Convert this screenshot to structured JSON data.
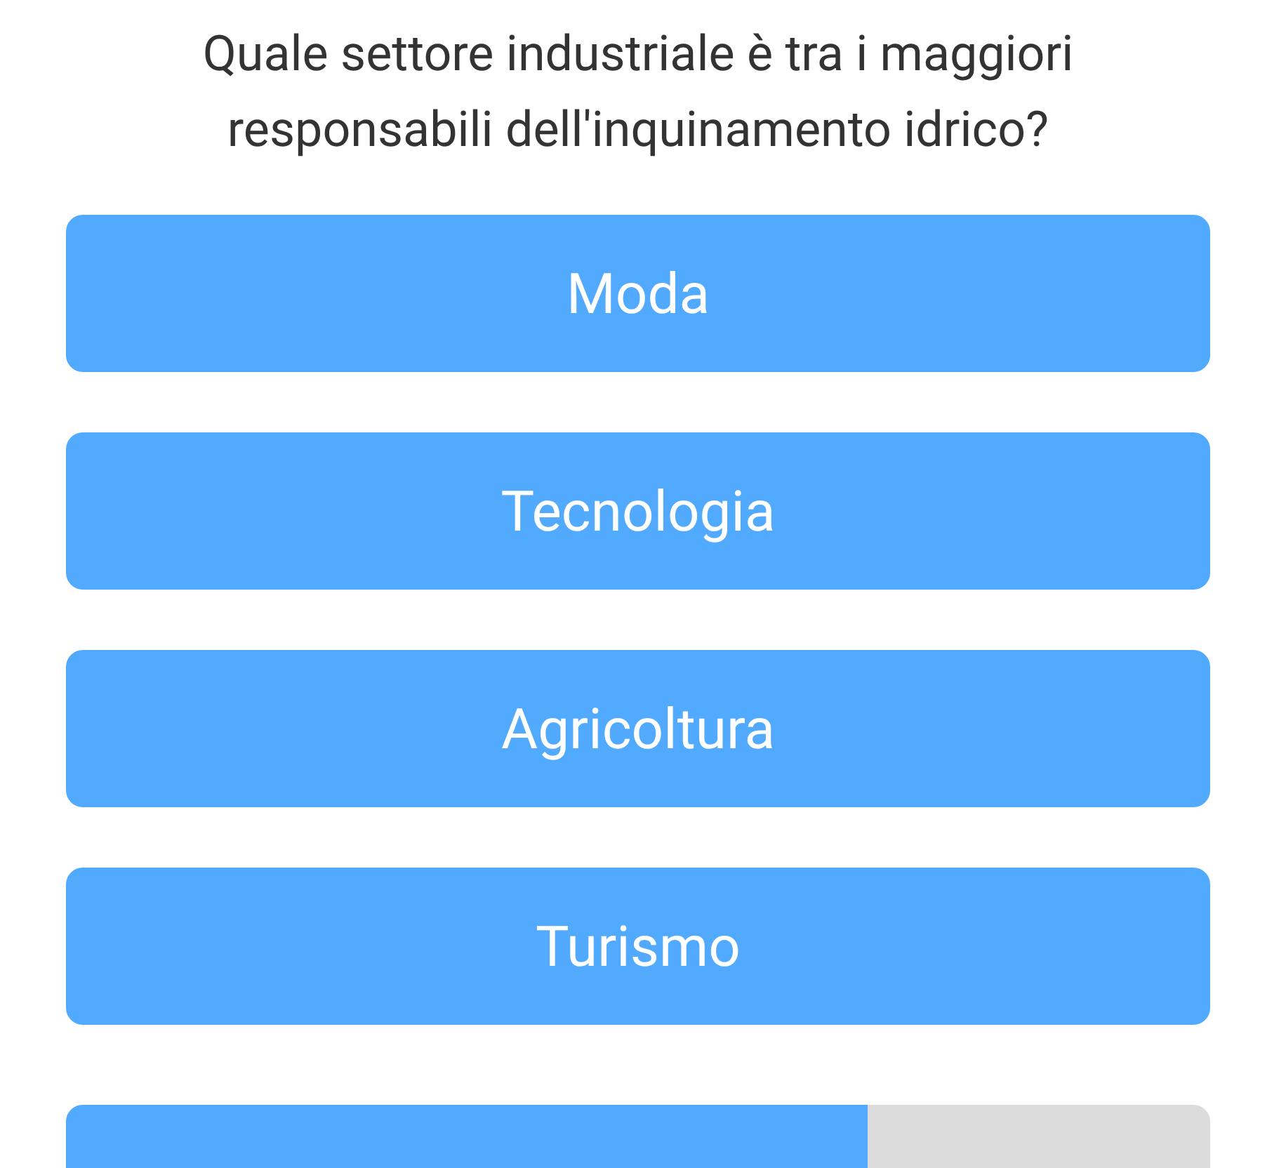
{
  "question": "Quale settore industriale è tra i maggiori responsabili dell'inquinamento idrico?",
  "answers": [
    {
      "label": "Moda"
    },
    {
      "label": "Tecnologia"
    },
    {
      "label": "Agricoltura"
    },
    {
      "label": "Turismo"
    }
  ],
  "progress": {
    "level": 0.7
  }
}
